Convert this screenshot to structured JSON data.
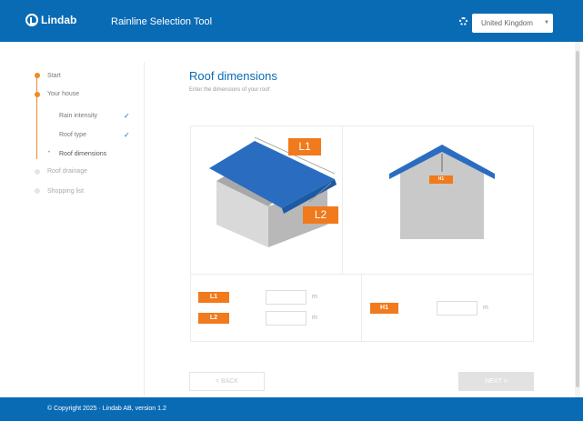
{
  "header": {
    "brand": "Lindab",
    "app_title": "Rainline Selection Tool",
    "country": "United Kingdom"
  },
  "steps": [
    {
      "label": "Start"
    },
    {
      "label": "Your house"
    },
    {
      "label": "Rain intensity"
    },
    {
      "label": "Roof type"
    },
    {
      "label": "Roof dimensions"
    },
    {
      "label": "Roof drainage"
    },
    {
      "label": "Shopping list"
    }
  ],
  "main": {
    "title": "Roof dimensions",
    "subtitle": "Enter the dimensions of your roof"
  },
  "diagram": {
    "l1_label": "L1",
    "l2_label": "L2",
    "h1_label": "H1",
    "roof_color": "#2a6dc0"
  },
  "form": {
    "l1_label": "L1",
    "l1_value": "",
    "l1_unit": "m",
    "l2_label": "L2",
    "l2_value": "",
    "l2_unit": "m",
    "h1_label": "H1",
    "h1_value": "",
    "h1_unit": "m"
  },
  "nav": {
    "back": "< BACK",
    "next": "NEXT >"
  },
  "footer": {
    "copyright": "© Copyright 2025 · Lindab AB, version 1.2"
  },
  "colors": {
    "brand_blue": "#0a6bb5",
    "accent_orange": "#f08a24"
  }
}
